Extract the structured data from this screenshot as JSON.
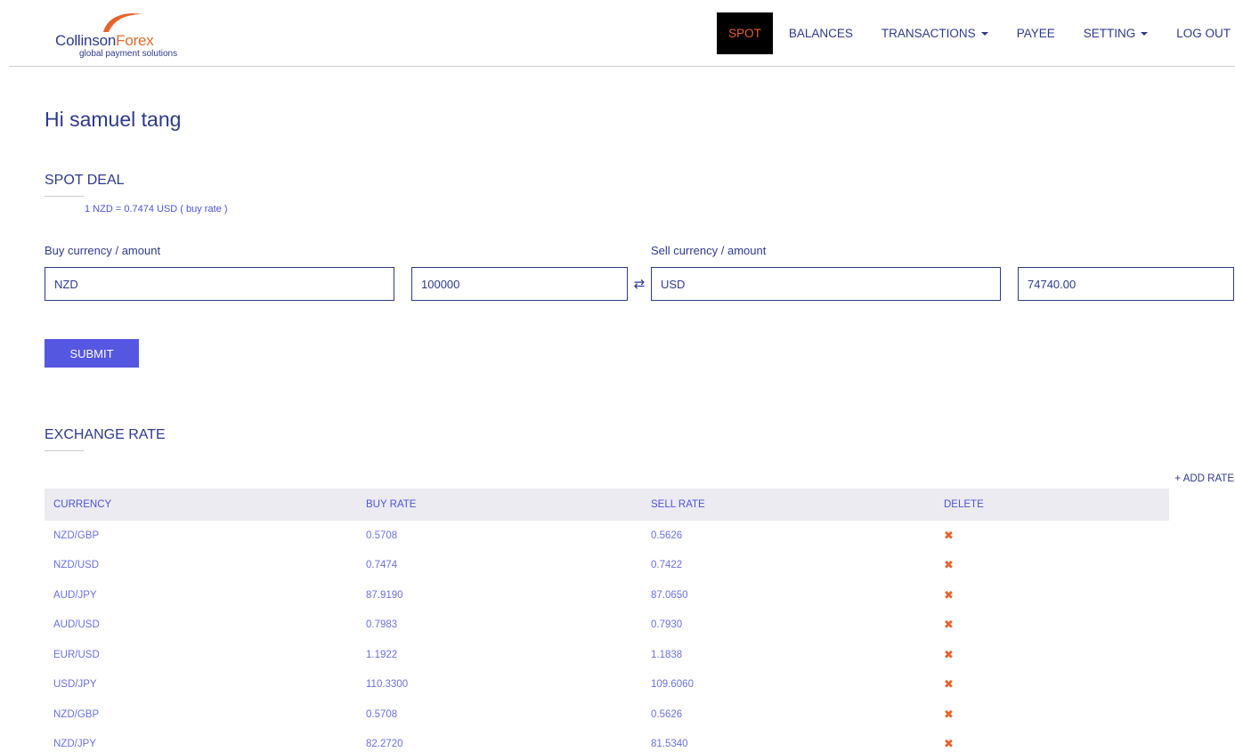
{
  "brand": {
    "name_part1": "Collinson",
    "name_part2": "Forex",
    "tagline": "global payment solutions",
    "accent_color": "#e8622a",
    "primary_color": "#2e3a8c"
  },
  "nav": {
    "spot": "SPOT",
    "balances": "BALANCES",
    "transactions": "TRANSACTIONS",
    "payee": "PAYEE",
    "setting": "SETTING",
    "logout": "LOG OUT",
    "active": "SPOT"
  },
  "greeting": "Hi samuel tang",
  "spot_deal": {
    "title": "SPOT DEAL",
    "rate_note": "1 NZD = 0.7474 USD  ( buy rate )",
    "buy_label": "Buy currency / amount",
    "sell_label": "Sell currency / amount",
    "buy_currency": "NZD",
    "buy_amount": "100000",
    "sell_currency": "USD",
    "sell_amount": "74740.00",
    "swap_icon": "⇄",
    "submit_label": "SUBMIT"
  },
  "exchange_rate": {
    "title": "EXCHANGE RATE",
    "add_rate_label": "+ ADD RATE",
    "columns": [
      "CURRENCY",
      "BUY RATE",
      "SELL RATE",
      "DELETE"
    ],
    "delete_icon": "✖",
    "rows": [
      {
        "currency": "NZD/GBP",
        "buy": "0.5708",
        "sell": "0.5626"
      },
      {
        "currency": "NZD/USD",
        "buy": "0.7474",
        "sell": "0.7422"
      },
      {
        "currency": "AUD/JPY",
        "buy": "87.9190",
        "sell": "87.0650"
      },
      {
        "currency": "AUD/USD",
        "buy": "0.7983",
        "sell": "0.7930"
      },
      {
        "currency": "EUR/USD",
        "buy": "1.1922",
        "sell": "1.1838"
      },
      {
        "currency": "USD/JPY",
        "buy": "110.3300",
        "sell": "109.6060"
      },
      {
        "currency": "NZD/GBP",
        "buy": "0.5708",
        "sell": "0.5626"
      },
      {
        "currency": "NZD/JPY",
        "buy": "82.2720",
        "sell": "81.5340"
      }
    ]
  }
}
